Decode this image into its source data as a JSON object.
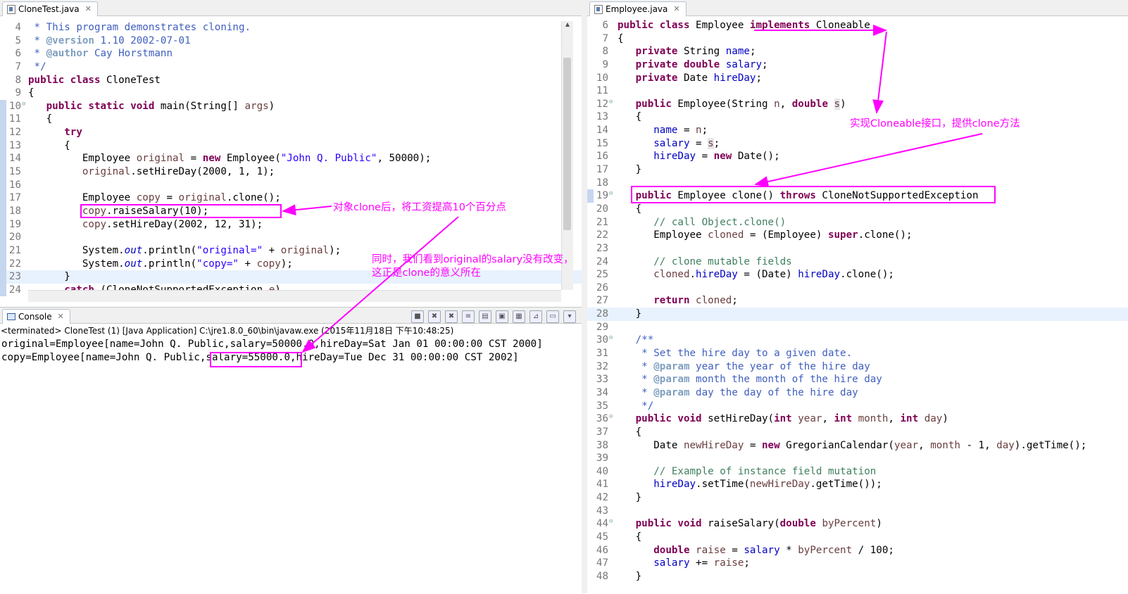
{
  "left_editor": {
    "tab_label": "CloneTest.java",
    "lines": [
      {
        "n": "4",
        "html": "<span class=\"d\"> * This program demonstrates cloning.</span>"
      },
      {
        "n": "5",
        "html": "<span class=\"d\"> * </span><span class=\"t\">@version</span><span class=\"d\"> 1.10 2002-07-01</span>"
      },
      {
        "n": "6",
        "html": "<span class=\"d\"> * </span><span class=\"t\">@author</span><span class=\"d\"> Cay Horstmann</span>"
      },
      {
        "n": "7",
        "html": "<span class=\"d\"> */</span>"
      },
      {
        "n": "8",
        "html": "<span class=\"k\">public class</span> CloneTest"
      },
      {
        "n": "9",
        "html": "{"
      },
      {
        "n": "10",
        "html": "   <span class=\"k\">public static void</span> main(String[] <span class=\"v\">args</span>)",
        "mark": true,
        "fold": true
      },
      {
        "n": "11",
        "html": "   {",
        "mark": true
      },
      {
        "n": "12",
        "html": "      <span class=\"k\">try</span>",
        "mark": true
      },
      {
        "n": "13",
        "html": "      {",
        "mark": true
      },
      {
        "n": "14",
        "html": "         Employee <span class=\"v\">original</span> = <span class=\"k\">new</span> Employee(<span class=\"s\">\"John Q. Public\"</span>, 50000);",
        "mark": true
      },
      {
        "n": "15",
        "html": "         <span class=\"v\">original</span>.setHireDay(2000, 1, 1);",
        "mark": true
      },
      {
        "n": "16",
        "html": "",
        "mark": true
      },
      {
        "n": "17",
        "html": "         Employee <span class=\"v\">copy</span> = <span class=\"v\">original</span>.clone();",
        "mark": true
      },
      {
        "n": "18",
        "html": "         <span class=\"v\">copy</span>.raiseSalary(10);",
        "mark": true
      },
      {
        "n": "19",
        "html": "         <span class=\"v\">copy</span>.setHireDay(2002, 12, 31);",
        "mark": true
      },
      {
        "n": "20",
        "html": "",
        "mark": true
      },
      {
        "n": "21",
        "html": "         System.<span class=\"f it\">out</span>.println(<span class=\"s\">\"original=\"</span> + <span class=\"v\">original</span>);",
        "mark": true
      },
      {
        "n": "22",
        "html": "         System.<span class=\"f it\">out</span>.println(<span class=\"s\">\"copy=\"</span> + <span class=\"v\">copy</span>);",
        "mark": true
      },
      {
        "n": "23",
        "html": "      }",
        "mark": true,
        "hl": true
      },
      {
        "n": "24",
        "html": "      <span class=\"k\">catch</span> (CloneNotSupportedException <span class=\"v\">e</span>)",
        "mark": true
      }
    ]
  },
  "right_editor": {
    "tab_label": "Employee.java",
    "lines": [
      {
        "n": "6",
        "html": "<span class=\"k\">public class</span> Employee <span class=\"k\">implements</span> Cloneable"
      },
      {
        "n": "7",
        "html": "{"
      },
      {
        "n": "8",
        "html": "   <span class=\"k\">private</span> String <span class=\"f\">name</span>;"
      },
      {
        "n": "9",
        "html": "   <span class=\"k\">private double</span> <span class=\"f\">salary</span>;"
      },
      {
        "n": "10",
        "html": "   <span class=\"k\">private</span> Date <span class=\"f\">hireDay</span>;"
      },
      {
        "n": "11",
        "html": ""
      },
      {
        "n": "12",
        "html": "   <span class=\"k\">public</span> Employee(String <span class=\"v\">n</span>, <span class=\"k\">double</span> <span class=\"v\" style=\"background:#e6e6e6\">s</span>)",
        "fold": true
      },
      {
        "n": "13",
        "html": "   {"
      },
      {
        "n": "14",
        "html": "      <span class=\"f\">name</span> = <span class=\"v\">n</span>;"
      },
      {
        "n": "15",
        "html": "      <span class=\"f\">salary</span> = <span class=\"v\" style=\"background:#e6e6e6\">s</span>;"
      },
      {
        "n": "16",
        "html": "      <span class=\"f\">hireDay</span> = <span class=\"k\">new</span> Date();"
      },
      {
        "n": "17",
        "html": "   }"
      },
      {
        "n": "18",
        "html": ""
      },
      {
        "n": "19",
        "html": "   <span class=\"k\">public</span> Employee clone() <span class=\"k\">throws</span> CloneNotSupportedException",
        "fold": true,
        "mark": true
      },
      {
        "n": "20",
        "html": "   {"
      },
      {
        "n": "21",
        "html": "      <span class=\"c\">// call Object.clone()</span>"
      },
      {
        "n": "22",
        "html": "      Employee <span class=\"v\">cloned</span> = (Employee) <span class=\"k\">super</span>.clone();"
      },
      {
        "n": "23",
        "html": ""
      },
      {
        "n": "24",
        "html": "      <span class=\"c\">// clone mutable fields</span>"
      },
      {
        "n": "25",
        "html": "      <span class=\"v\">cloned</span>.<span class=\"f\">hireDay</span> = (Date) <span class=\"f\">hireDay</span>.clone();"
      },
      {
        "n": "26",
        "html": ""
      },
      {
        "n": "27",
        "html": "      <span class=\"k\">return</span> <span class=\"v\">cloned</span>;"
      },
      {
        "n": "28",
        "html": "   }",
        "hl": true
      },
      {
        "n": "29",
        "html": ""
      },
      {
        "n": "30",
        "html": "   <span class=\"d\">/**</span>",
        "fold": true
      },
      {
        "n": "31",
        "html": "<span class=\"d\">    * Set the hire day to a given date.</span>"
      },
      {
        "n": "32",
        "html": "<span class=\"d\">    * </span><span class=\"t\">@param</span><span class=\"d\"> year the year of the hire day</span>"
      },
      {
        "n": "33",
        "html": "<span class=\"d\">    * </span><span class=\"t\">@param</span><span class=\"d\"> month the month of the hire day</span>"
      },
      {
        "n": "34",
        "html": "<span class=\"d\">    * </span><span class=\"t\">@param</span><span class=\"d\"> day the day of the hire day</span>"
      },
      {
        "n": "35",
        "html": "<span class=\"d\">    */</span>"
      },
      {
        "n": "36",
        "html": "   <span class=\"k\">public void</span> setHireDay(<span class=\"k\">int</span> <span class=\"v\">year</span>, <span class=\"k\">int</span> <span class=\"v\">month</span>, <span class=\"k\">int</span> <span class=\"v\">day</span>)",
        "fold": true
      },
      {
        "n": "37",
        "html": "   {"
      },
      {
        "n": "38",
        "html": "      Date <span class=\"v\">newHireDay</span> = <span class=\"k\">new</span> GregorianCalendar(<span class=\"v\">year</span>, <span class=\"v\">month</span> - 1, <span class=\"v\">day</span>).getTime();"
      },
      {
        "n": "39",
        "html": ""
      },
      {
        "n": "40",
        "html": "      <span class=\"c\">// Example of instance field mutation</span>"
      },
      {
        "n": "41",
        "html": "      <span class=\"f\">hireDay</span>.setTime(<span class=\"v\">newHireDay</span>.getTime());"
      },
      {
        "n": "42",
        "html": "   }"
      },
      {
        "n": "43",
        "html": ""
      },
      {
        "n": "44",
        "html": "   <span class=\"k\">public void</span> raiseSalary(<span class=\"k\">double</span> <span class=\"v\">byPercent</span>)",
        "fold": true
      },
      {
        "n": "45",
        "html": "   {"
      },
      {
        "n": "46",
        "html": "      <span class=\"k\">double</span> <span class=\"v\">raise</span> = <span class=\"f\">salary</span> * <span class=\"v\">byPercent</span> / 100;"
      },
      {
        "n": "47",
        "html": "      <span class=\"f\">salary</span> += <span class=\"v\">raise</span>;"
      },
      {
        "n": "48",
        "html": "   }"
      }
    ]
  },
  "console": {
    "tab_label": "Console",
    "status": "<terminated> CloneTest (1) [Java Application] C:\\jre1.8.0_60\\bin\\javaw.exe (2015年11月18日 下午10:48:25)",
    "output_lines": [
      "original=Employee[name=John Q. Public,salary=50000.0,hireDay=Sat Jan 01 00:00:00 CST 2000]",
      "copy=Employee[name=John Q. Public,salary=55000.0,hireDay=Tue Dec 31 00:00:00 CST 2002]"
    ]
  },
  "annotations": {
    "note_clone_raise": "对象clone后，将工资提高10个百分点",
    "note_original_unchanged_1": "同时，我们看到original的salary没有改变，",
    "note_original_unchanged_2": "这正是clone的意义所在",
    "note_implements": "实现Cloneable接口，提供clone方法"
  },
  "colors": {
    "annotation": "#ff00ff",
    "keyword": "#7f0055",
    "string": "#2a00ff",
    "field": "#0000c0",
    "comment": "#3f7f5f",
    "javadoc": "#3f5fbf"
  }
}
